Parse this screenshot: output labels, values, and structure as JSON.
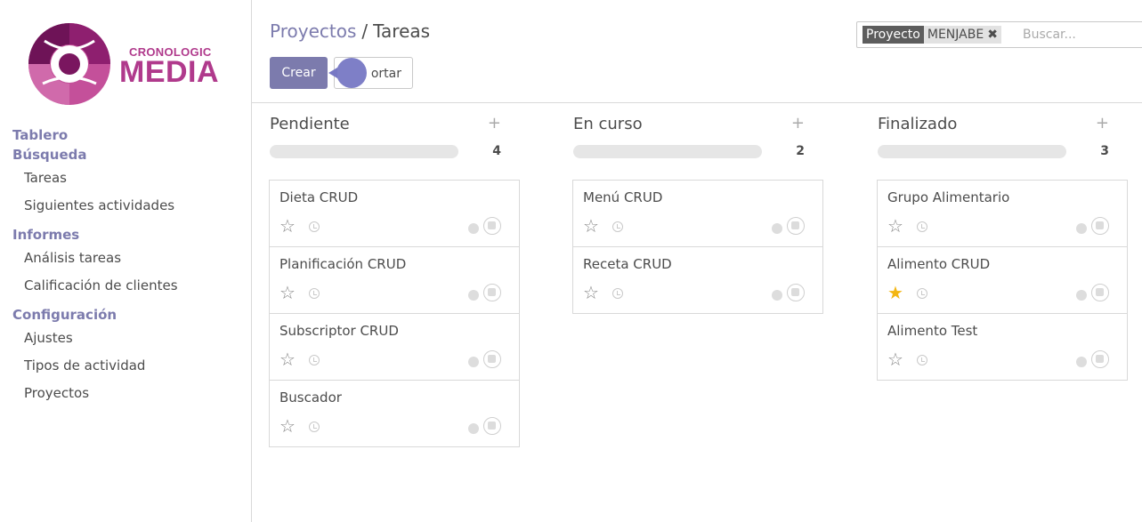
{
  "brand": {
    "top": "CRONOLOGIC",
    "main": "MEDIA"
  },
  "sidebar": {
    "sections": [
      {
        "title": "Tablero"
      },
      {
        "title": "Búsqueda",
        "items": [
          "Tareas",
          "Siguientes actividades"
        ]
      },
      {
        "title": "Informes",
        "items": [
          "Análisis tareas",
          "Calificación de clientes"
        ]
      },
      {
        "title": "Configuración",
        "items": [
          "Ajustes",
          "Tipos de actividad",
          "Proyectos"
        ]
      }
    ]
  },
  "header": {
    "breadcrumb_parent": "Proyectos",
    "breadcrumb_sep": "/",
    "breadcrumb_current": "Tareas",
    "create_label": "Crear",
    "import_label": "ortar"
  },
  "search": {
    "facet_label": "Proyecto",
    "facet_value": "MENJABE",
    "facet_remove": "✖",
    "placeholder": "Buscar..."
  },
  "columns": [
    {
      "title": "Pendiente",
      "count": "4",
      "add": "+",
      "cards": [
        {
          "name": "Dieta CRUD",
          "starred": false
        },
        {
          "name": "Planificación CRUD",
          "starred": false
        },
        {
          "name": "Subscriptor CRUD",
          "starred": false
        },
        {
          "name": "Buscador",
          "starred": false
        }
      ]
    },
    {
      "title": "En curso",
      "count": "2",
      "add": "+",
      "cards": [
        {
          "name": "Menú CRUD",
          "starred": false
        },
        {
          "name": "Receta CRUD",
          "starred": false
        }
      ]
    },
    {
      "title": "Finalizado",
      "count": "3",
      "add": "+",
      "cards": [
        {
          "name": "Grupo Alimentario",
          "starred": false
        },
        {
          "name": "Alimento CRUD",
          "starred": true
        },
        {
          "name": "Alimento Test",
          "starred": false
        }
      ]
    }
  ],
  "colors": {
    "accent": "#7c7bad",
    "brand": "#b03a8c",
    "star_on": "#f3b612"
  },
  "icons": {
    "star": "star-icon",
    "clock": "clock-icon",
    "add": "plus-icon",
    "remove": "close-icon",
    "avatar": "avatar-icon"
  }
}
